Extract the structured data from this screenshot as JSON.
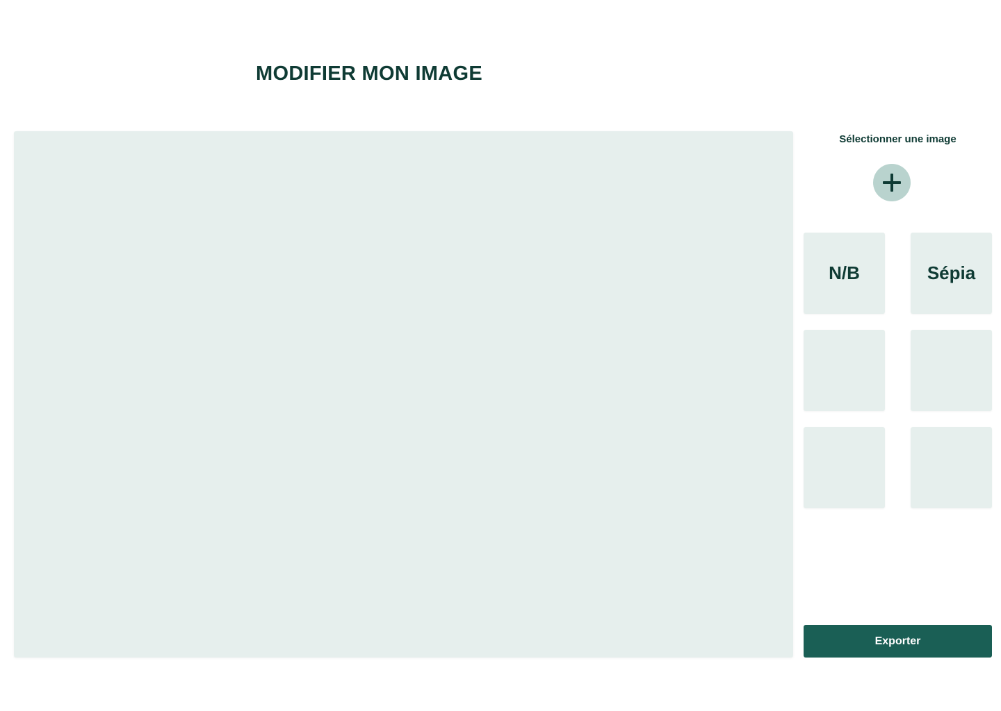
{
  "page": {
    "title": "MODIFIER MON IMAGE"
  },
  "sidebar": {
    "select_label": "Sélectionner une image",
    "add_icon": "plus-icon",
    "filters": [
      {
        "label": "N/B"
      },
      {
        "label": "Sépia"
      },
      {
        "label": ""
      },
      {
        "label": ""
      },
      {
        "label": ""
      },
      {
        "label": ""
      }
    ],
    "export_label": "Exporter"
  },
  "colors": {
    "primary_dark": "#0f3b34",
    "accent": "#1a5f55",
    "panel_bg": "#e6efed",
    "add_button_bg": "#b9d3ce"
  }
}
